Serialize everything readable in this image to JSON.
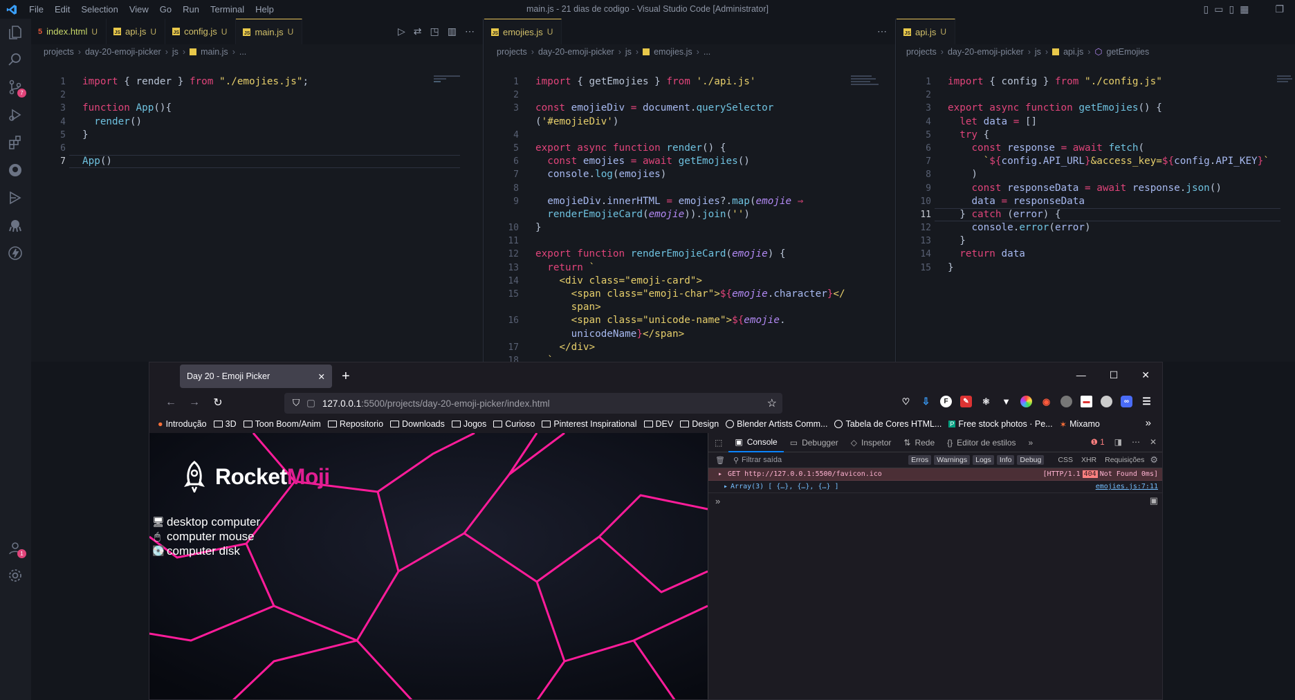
{
  "titlebar": {
    "menu": [
      "File",
      "Edit",
      "Selection",
      "View",
      "Go",
      "Run",
      "Terminal",
      "Help"
    ],
    "title": "main.js - 21 dias de codigo - Visual Studio Code [Administrator]"
  },
  "activity": {
    "source_control_badge": "7",
    "account_badge": "1"
  },
  "group1": {
    "tabs": [
      {
        "label": "index.html",
        "status": "U",
        "type": "html"
      },
      {
        "label": "api.js",
        "status": "U",
        "type": "js"
      },
      {
        "label": "config.js",
        "status": "U",
        "type": "js"
      },
      {
        "label": "main.js",
        "status": "U",
        "type": "js"
      }
    ],
    "breadcrumb": [
      "projects",
      "day-20-emoji-picker",
      "js",
      "main.js",
      "..."
    ],
    "current_line": "7"
  },
  "group2": {
    "tabs": [
      {
        "label": "emojies.js",
        "status": "U",
        "type": "js"
      }
    ],
    "breadcrumb": [
      "projects",
      "day-20-emoji-picker",
      "js",
      "emojies.js",
      "..."
    ]
  },
  "group3": {
    "tabs": [
      {
        "label": "api.js",
        "status": "U",
        "type": "js"
      }
    ],
    "breadcrumb": [
      "projects",
      "day-20-emoji-picker",
      "js",
      "api.js",
      "getEmojies"
    ],
    "current_line": "11"
  },
  "browser": {
    "tab_title": "Day 20 - Emoji Picker",
    "url_host": "127.0.0.1",
    "url_rest": ":5500/projects/day-20-emoji-picker/index.html",
    "bookmarks": [
      "Introdução",
      "3D",
      "Toon Boom/Anim",
      "Repositorio",
      "Downloads",
      "Jogos",
      "Curioso",
      "Pinterest Inspirational",
      "DEV",
      "Design",
      "Blender Artists Comm...",
      "Tabela de Cores HTML...",
      "Free stock photos · Pe...",
      "Mixamo"
    ],
    "page": {
      "brand_a": "Rocket",
      "brand_b": "Moji",
      "emojis": [
        {
          "char": "🖥",
          "name": "desktop computer"
        },
        {
          "char": "🖱",
          "name": "computer mouse"
        },
        {
          "char": "💽",
          "name": "computer disk"
        }
      ]
    },
    "devtools": {
      "tabs": [
        "Console",
        "Debugger",
        "Inspetor",
        "Rede",
        "Editor de estilos"
      ],
      "error_count": "1",
      "filter_placeholder": "Filtrar saída",
      "filters": [
        "Erros",
        "Warnings",
        "Logs",
        "Info",
        "Debug"
      ],
      "filters_plain": [
        "CSS",
        "XHR",
        "Requisições"
      ],
      "messages": [
        {
          "text": "GET http://127.0.0.1:5500/favicon.ico",
          "status_a": "[HTTP/1.1",
          "status_code": "404",
          "status_b": "Not Found 0ms]"
        },
        {
          "text": "Array(3) [ {…}, {…}, {…} ]",
          "source": "emojies.js:7:11"
        }
      ]
    }
  }
}
